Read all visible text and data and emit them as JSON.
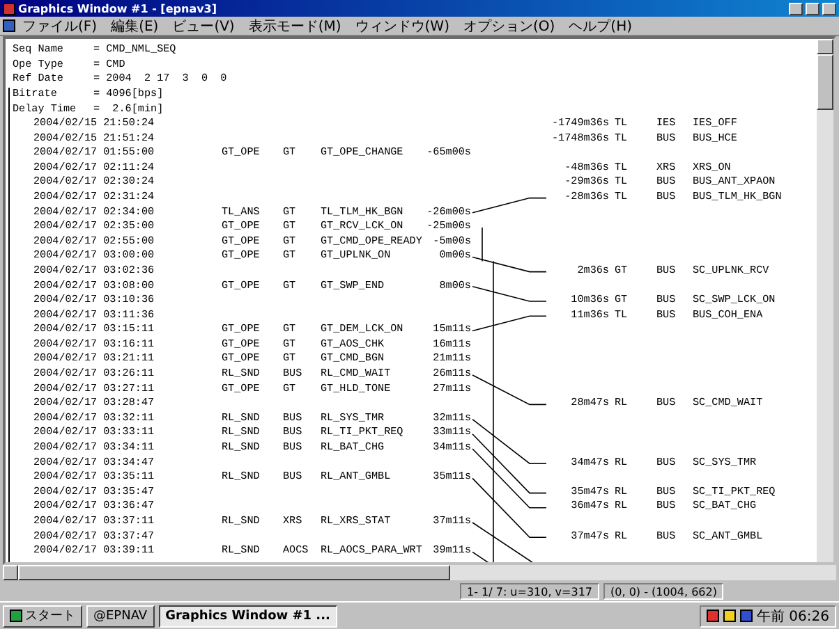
{
  "window": {
    "title": "Graphics Window #1 - [epnav3]"
  },
  "menu": [
    "ファイル(F)",
    "編集(E)",
    "ビュー(V)",
    "表示モード(M)",
    "ウィンドウ(W)",
    "オプション(O)",
    "ヘルプ(H)"
  ],
  "header": [
    {
      "label": "Seq Name",
      "value": "= CMD_NML_SEQ"
    },
    {
      "label": "Ope Type",
      "value": "= CMD"
    },
    {
      "label": "Ref Date",
      "value": "= 2004  2 17  3  0  0"
    },
    {
      "label": "Bitrate",
      "value": "= 4096[bps]"
    },
    {
      "label": "Delay Time",
      "value": "=  2.6[min]"
    }
  ],
  "rows": [
    {
      "time": "2004/02/15 21:50:24",
      "response": {
        "offset": "-1749m36s",
        "source": "TL",
        "unit": "IES",
        "name": "IES_OFF",
        "linked": false
      }
    },
    {
      "time": "2004/02/15 21:51:24",
      "response": {
        "offset": "-1748m36s",
        "source": "TL",
        "unit": "BUS",
        "name": "BUS_HCE",
        "linked": false
      }
    },
    {
      "time": "2004/02/17 01:55:00",
      "event": {
        "group": "GT_OPE",
        "unit": "GT",
        "name": "GT_OPE_CHANGE",
        "offset": "-65m00s",
        "linked": false
      }
    },
    {
      "time": "2004/02/17 02:11:24",
      "response": {
        "offset": "-48m36s",
        "source": "TL",
        "unit": "XRS",
        "name": "XRS_ON",
        "linked": false
      }
    },
    {
      "time": "2004/02/17 02:30:24",
      "response": {
        "offset": "-29m36s",
        "source": "TL",
        "unit": "BUS",
        "name": "BUS_ANT_XPAON",
        "linked": false
      }
    },
    {
      "time": "2004/02/17 02:31:24",
      "response": {
        "offset": "-28m36s",
        "source": "TL",
        "unit": "BUS",
        "name": "BUS_TLM_HK_BGN",
        "linked": true
      }
    },
    {
      "time": "2004/02/17 02:34:00",
      "event": {
        "group": "TL_ANS",
        "unit": "GT",
        "name": "TL_TLM_HK_BGN",
        "offset": "-26m00s",
        "linked": true
      }
    },
    {
      "time": "2004/02/17 02:35:00",
      "event": {
        "group": "GT_OPE",
        "unit": "GT",
        "name": "GT_RCV_LCK_ON",
        "offset": "-25m00s",
        "linked": false
      }
    },
    {
      "time": "2004/02/17 02:55:00",
      "event": {
        "group": "GT_OPE",
        "unit": "GT",
        "name": "GT_CMD_OPE_READY",
        "offset": "-5m00s",
        "linked": false
      }
    },
    {
      "time": "2004/02/17 03:00:00",
      "event": {
        "group": "GT_OPE",
        "unit": "GT",
        "name": "GT_UPLNK_ON",
        "offset": "0m00s",
        "linked": true
      }
    },
    {
      "time": "2004/02/17 03:02:36",
      "response": {
        "offset": "2m36s",
        "source": "GT",
        "unit": "BUS",
        "name": "SC_UPLNK_RCV",
        "linked": true
      }
    },
    {
      "time": "2004/02/17 03:08:00",
      "event": {
        "group": "GT_OPE",
        "unit": "GT",
        "name": "GT_SWP_END",
        "offset": "8m00s",
        "linked": true
      }
    },
    {
      "time": "2004/02/17 03:10:36",
      "response": {
        "offset": "10m36s",
        "source": "GT",
        "unit": "BUS",
        "name": "SC_SWP_LCK_ON",
        "linked": true
      }
    },
    {
      "time": "2004/02/17 03:11:36",
      "response": {
        "offset": "11m36s",
        "source": "TL",
        "unit": "BUS",
        "name": "BUS_COH_ENA",
        "linked": true
      }
    },
    {
      "time": "2004/02/17 03:15:11",
      "event": {
        "group": "GT_OPE",
        "unit": "GT",
        "name": "GT_DEM_LCK_ON",
        "offset": "15m11s",
        "linked": true
      }
    },
    {
      "time": "2004/02/17 03:16:11",
      "event": {
        "group": "GT_OPE",
        "unit": "GT",
        "name": "GT_AOS_CHK",
        "offset": "16m11s",
        "linked": false
      }
    },
    {
      "time": "2004/02/17 03:21:11",
      "event": {
        "group": "GT_OPE",
        "unit": "GT",
        "name": "GT_CMD_BGN",
        "offset": "21m11s",
        "linked": false
      }
    },
    {
      "time": "2004/02/17 03:26:11",
      "event": {
        "group": "RL_SND",
        "unit": "BUS",
        "name": "RL_CMD_WAIT",
        "offset": "26m11s",
        "linked": true
      }
    },
    {
      "time": "2004/02/17 03:27:11",
      "event": {
        "group": "GT_OPE",
        "unit": "GT",
        "name": "GT_HLD_TONE",
        "offset": "27m11s",
        "linked": false
      }
    },
    {
      "time": "2004/02/17 03:28:47",
      "response": {
        "offset": "28m47s",
        "source": "RL",
        "unit": "BUS",
        "name": "SC_CMD_WAIT",
        "linked": true
      }
    },
    {
      "time": "2004/02/17 03:32:11",
      "event": {
        "group": "RL_SND",
        "unit": "BUS",
        "name": "RL_SYS_TMR",
        "offset": "32m11s",
        "linked": true
      }
    },
    {
      "time": "2004/02/17 03:33:11",
      "event": {
        "group": "RL_SND",
        "unit": "BUS",
        "name": "RL_TI_PKT_REQ",
        "offset": "33m11s",
        "linked": true
      }
    },
    {
      "time": "2004/02/17 03:34:11",
      "event": {
        "group": "RL_SND",
        "unit": "BUS",
        "name": "RL_BAT_CHG",
        "offset": "34m11s",
        "linked": true
      }
    },
    {
      "time": "2004/02/17 03:34:47",
      "response": {
        "offset": "34m47s",
        "source": "RL",
        "unit": "BUS",
        "name": "SC_SYS_TMR",
        "linked": true
      }
    },
    {
      "time": "2004/02/17 03:35:11",
      "event": {
        "group": "RL_SND",
        "unit": "BUS",
        "name": "RL_ANT_GMBL",
        "offset": "35m11s",
        "linked": true
      }
    },
    {
      "time": "2004/02/17 03:35:47",
      "response": {
        "offset": "35m47s",
        "source": "RL",
        "unit": "BUS",
        "name": "SC_TI_PKT_REQ",
        "linked": true
      }
    },
    {
      "time": "2004/02/17 03:36:47",
      "response": {
        "offset": "36m47s",
        "source": "RL",
        "unit": "BUS",
        "name": "SC_BAT_CHG",
        "linked": true
      }
    },
    {
      "time": "2004/02/17 03:37:11",
      "event": {
        "group": "RL_SND",
        "unit": "XRS",
        "name": "RL_XRS_STAT",
        "offset": "37m11s",
        "linked": true
      }
    },
    {
      "time": "2004/02/17 03:37:47",
      "response": {
        "offset": "37m47s",
        "source": "RL",
        "unit": "BUS",
        "name": "SC_ANT_GMBL",
        "linked": true
      }
    },
    {
      "time": "2004/02/17 03:39:11",
      "event": {
        "group": "RL_SND",
        "unit": "AOCS",
        "name": "RL_AOCS_PARA_WRT",
        "offset": "39m11s",
        "linked": true
      }
    }
  ],
  "status_bar": [
    "1- 1/ 7: u=310, v=317",
    "(0, 0) - (1004, 662)"
  ],
  "taskbar": {
    "start": "スタート",
    "tasks": [
      {
        "label": "@EPNAV",
        "selected": false
      },
      {
        "label": "Graphics Window #1 ...",
        "selected": true
      }
    ],
    "clock": "午前 06:26"
  }
}
